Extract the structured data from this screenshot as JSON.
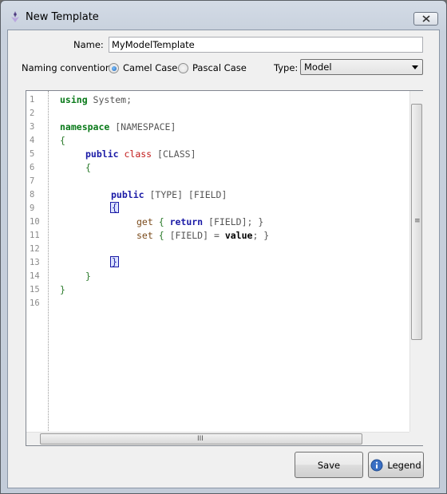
{
  "window": {
    "title": "New Template"
  },
  "form": {
    "name_label": "Name:",
    "name_value": "MyModelTemplate",
    "naming_label": "Naming convention:",
    "camel_label": "Camel Case",
    "pascal_label": "Pascal Case",
    "naming_selected": "Camel Case",
    "type_label": "Type:",
    "type_value": "Model"
  },
  "editor": {
    "line_numbers": [
      "1",
      "2",
      "3",
      "4",
      "5",
      "6",
      "7",
      "8",
      "9",
      "10",
      "11",
      "12",
      "13",
      "14",
      "15",
      "16"
    ],
    "code": {
      "l1_kw": "using",
      "l1_rest": " System;",
      "l3_kw": "namespace",
      "l3_rest": " [NAMESPACE]",
      "l4": "{",
      "l5_kw": "public",
      "l5_kw2": "class",
      "l5_rest": " [CLASS]",
      "l6": "{",
      "l8_kw": "public",
      "l8_rest": " [TYPE] [FIELD]",
      "l9": "{",
      "l10_kw": "get",
      "l10_b1": " { ",
      "l10_kw2": "return",
      "l10_rest": " [FIELD]; }",
      "l11_kw": "set",
      "l11_b1": " { ",
      "l11_mid": "[FIELD] = ",
      "l11_kw2": "value",
      "l11_rest": "; }",
      "l13": "}",
      "l14": "}",
      "l15": "}"
    },
    "hscroll_grip": "III",
    "vscroll_grip": "≡"
  },
  "buttons": {
    "save": "Save",
    "legend": "Legend"
  },
  "colors": {
    "keyword_green": "#0a7a1a",
    "keyword_blue": "#1a1aa6",
    "keyword_red": "#c21a1a"
  }
}
